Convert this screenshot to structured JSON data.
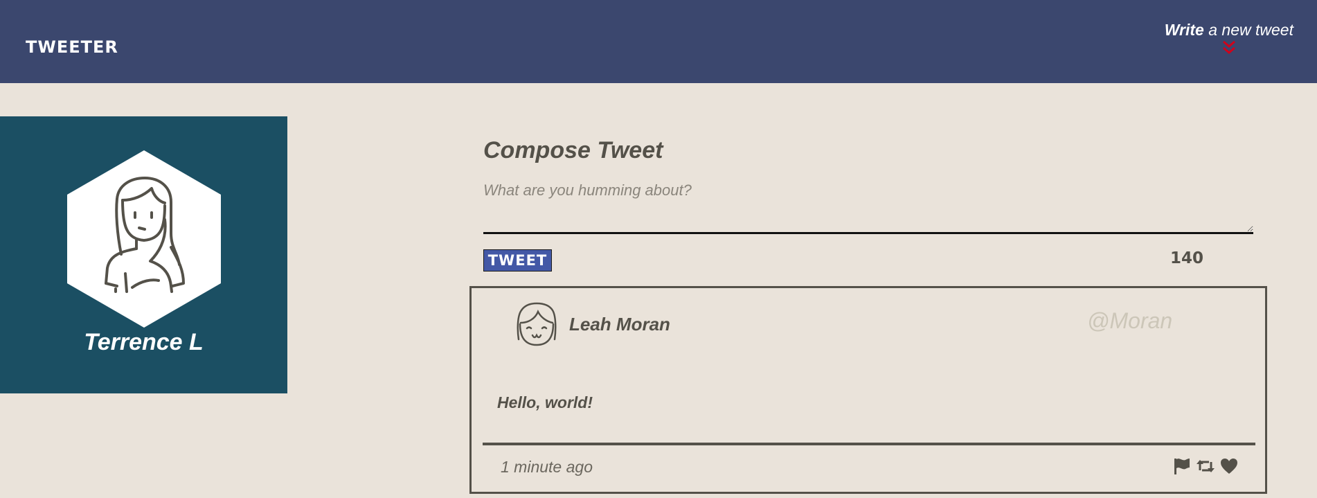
{
  "nav": {
    "brand": "TWEETER",
    "write_strong": "Write",
    "write_rest": " a new tweet",
    "arrow_icon": "double-chevron-down-icon",
    "arrow_color": "#d0021b"
  },
  "profile": {
    "name": "Terrence L",
    "avatar_icon": "user-avatar-icon"
  },
  "compose": {
    "title": "Compose Tweet",
    "placeholder": "What are you humming about?",
    "button_label": "TWEET",
    "counter": "140"
  },
  "tweet": {
    "name": "Leah Moran",
    "handle": "@Moran",
    "body": "Hello, world!",
    "time": "1 minute ago",
    "avatar_icon": "user-avatar-icon",
    "actions": [
      "flag-icon",
      "retweet-icon",
      "heart-icon"
    ]
  },
  "colors": {
    "navbar": "#3b476e",
    "background": "#eae3da",
    "profile_card": "#1b4f63",
    "tweet_button": "#4358a6",
    "text": "#545149"
  }
}
